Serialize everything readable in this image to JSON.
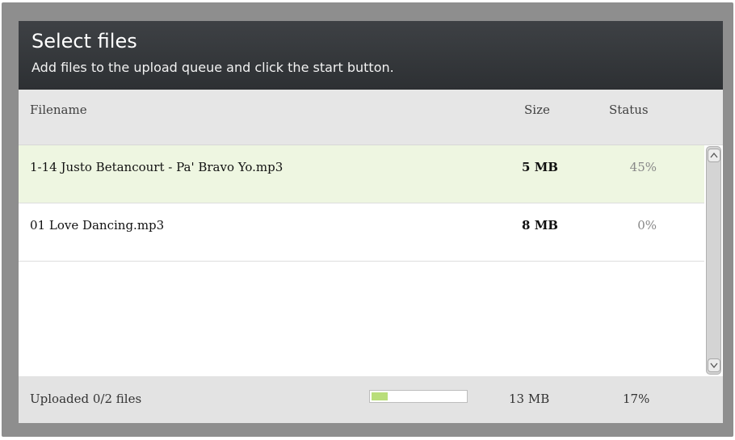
{
  "header": {
    "title": "Select files",
    "subtitle": "Add files to the upload queue and click the start button."
  },
  "columns": {
    "filename": "Filename",
    "size": "Size",
    "status": "Status"
  },
  "files": [
    {
      "name": "1-14 Justo Betancourt - Pa' Bravo Yo.mp3",
      "size": "5 MB",
      "status": "45%",
      "active": true
    },
    {
      "name": "01 Love Dancing.mp3",
      "size": "8 MB",
      "status": "0%",
      "active": false
    }
  ],
  "footer": {
    "uploaded_text": "Uploaded 0/2 files",
    "total_size": "13 MB",
    "total_percent": "17%",
    "progress_fraction": 0.17
  },
  "colors": {
    "header_bg": "#2d3033",
    "active_row_bg": "#eef6e1",
    "progress_fill": "#b9de7a"
  },
  "icons": {
    "scroll_up": "chevron-up-icon",
    "scroll_down": "chevron-down-icon"
  }
}
